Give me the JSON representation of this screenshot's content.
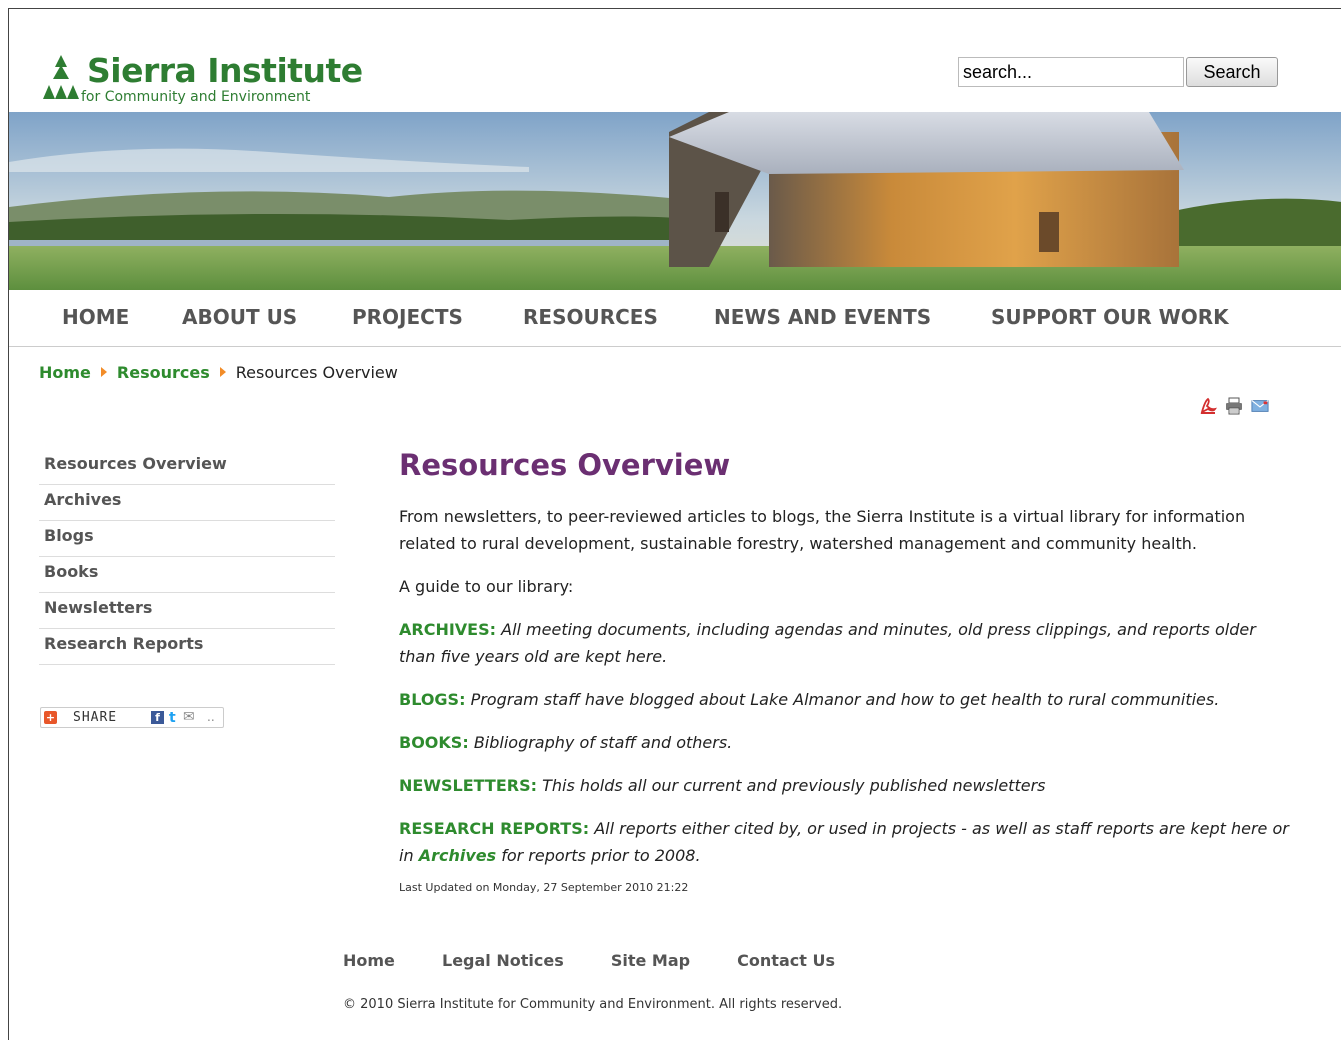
{
  "header": {
    "logo_name": "Sierra Institute",
    "logo_tagline": "for Community and Environment",
    "search_placeholder": "search...",
    "search_button": "Search"
  },
  "nav": {
    "items": [
      "HOME",
      "ABOUT US",
      "PROJECTS",
      "RESOURCES",
      "NEWS AND EVENTS",
      "SUPPORT OUR WORK"
    ]
  },
  "breadcrumb": {
    "home": "Home",
    "section": "Resources",
    "current": "Resources Overview"
  },
  "tools": {
    "icons": [
      "pdf-icon",
      "print-icon",
      "email-icon"
    ]
  },
  "side_menu": {
    "items": [
      "Resources Overview",
      "Archives",
      "Blogs",
      "Books",
      "Newsletters",
      "Research Reports"
    ],
    "share_label": "SHARE"
  },
  "content": {
    "title": "Resources Overview",
    "intro": "From newsletters, to peer-reviewed articles to blogs, the Sierra Institute is a virtual library for information related to rural development, sustainable forestry, watershed management and community health.",
    "guide": "A guide to our library:",
    "entries": [
      {
        "label": "ARCHIVES:",
        "text": "All meeting documents, including agendas and minutes, old press clippings, and reports older than five years old are kept here."
      },
      {
        "label": "BLOGS:",
        "text": "Program staff have blogged about Lake Almanor and how to get health to rural communities."
      },
      {
        "label": "BOOKS:",
        "text": "Bibliography of staff and others."
      },
      {
        "label": "NEWSLETTERS:",
        "text": "This holds all our current and previously published newsletters"
      },
      {
        "label": "RESEARCH REPORTS:",
        "text": "All reports either cited by, or used in projects - as well as staff reports are kept here or in",
        "link": "Archives",
        "after": "for reports prior to 2008."
      }
    ],
    "last_updated": "Last Updated on Monday, 27 September 2010 21:22"
  },
  "footer": {
    "links": [
      "Home",
      "Legal Notices",
      "Site Map",
      "Contact Us"
    ],
    "copyright": "© 2010 Sierra Institute for Community and Environment. All rights reserved."
  },
  "colors": {
    "brand_green": "#2e7d32",
    "link_green": "#2e8b2e",
    "title_purple": "#6b2f72",
    "breadcrumb_arrow": "#f28c28"
  }
}
